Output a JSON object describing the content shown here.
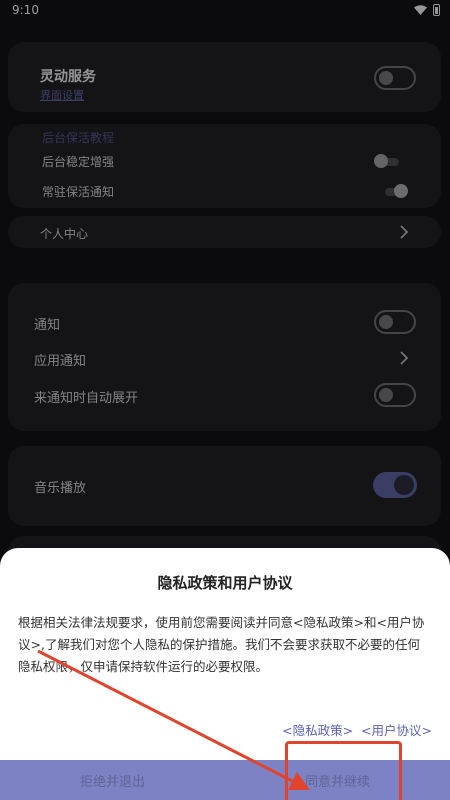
{
  "status_bar": {
    "time": "9:10"
  },
  "card1": {
    "title": "灵动服务",
    "subtitle": "界面设置"
  },
  "card2": {
    "header": "后台保活教程",
    "row1": "后台稳定增强",
    "row2": "常驻保活通知"
  },
  "card3": {
    "label": "个人中心"
  },
  "card4": {
    "row1": "通知",
    "row2": "应用通知",
    "row3": "来通知时自动展开"
  },
  "card5": {
    "label": "音乐播放"
  },
  "dialog": {
    "title": "隐私政策和用户协议",
    "body": "根据相关法律法规要求，使用前您需要阅读并同意<隐私政策>和<用户协议>,了解我们对您个人隐私的保护措施。我们不会要求获取不必要的任何隐私权限，仅申请保持软件运行的必要权限。",
    "link_privacy": "<隐私政策>",
    "link_terms": "<用户协议>",
    "reject_button": "拒绝并退出",
    "accept_button": "同意并继续"
  },
  "colors": {
    "background": "#111114",
    "card": "#1f1f24",
    "accent": "#7d82c4",
    "link": "#5b61b8",
    "annotation": "#e0442c"
  },
  "icons": [
    "wifi-icon",
    "battery-icon",
    "chevron-right-icon"
  ]
}
